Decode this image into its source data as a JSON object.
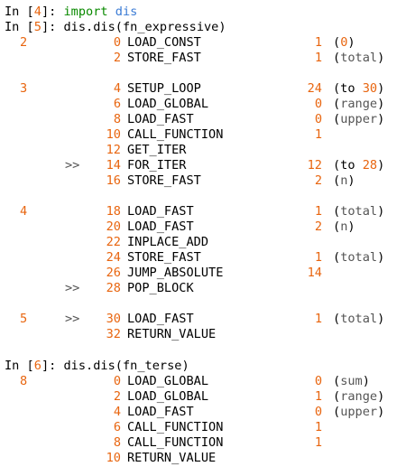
{
  "cells": [
    {
      "prompt_prefix": "In [",
      "prompt_num": "4",
      "prompt_suffix": "]: ",
      "kw": "import",
      "space": " ",
      "module": "dis"
    },
    {
      "prompt_prefix": "In [",
      "prompt_num": "5",
      "prompt_suffix": "]: ",
      "code": "dis.dis(fn_expressive)"
    },
    {
      "prompt_prefix": "In [",
      "prompt_num": "6",
      "prompt_suffix": "]: ",
      "code": "dis.dis(fn_terse)"
    }
  ],
  "disasm_expressive": [
    {
      "lineno": "2",
      "marker": "",
      "offset": "0",
      "opname": "LOAD_CONST",
      "arg": "1",
      "pre": "(",
      "num": "0",
      "str": "",
      "post": ")"
    },
    {
      "lineno": "",
      "marker": "",
      "offset": "2",
      "opname": "STORE_FAST",
      "arg": "1",
      "pre": "(",
      "num": "",
      "str": "total",
      "post": ")"
    },
    {
      "lineno": "3",
      "marker": "",
      "offset": "4",
      "opname": "SETUP_LOOP",
      "arg": "24",
      "pre": "(to ",
      "num": "30",
      "str": "",
      "post": ")"
    },
    {
      "lineno": "",
      "marker": "",
      "offset": "6",
      "opname": "LOAD_GLOBAL",
      "arg": "0",
      "pre": "(",
      "num": "",
      "str": "range",
      "post": ")"
    },
    {
      "lineno": "",
      "marker": "",
      "offset": "8",
      "opname": "LOAD_FAST",
      "arg": "0",
      "pre": "(",
      "num": "",
      "str": "upper",
      "post": ")"
    },
    {
      "lineno": "",
      "marker": "",
      "offset": "10",
      "opname": "CALL_FUNCTION",
      "arg": "1",
      "pre": "",
      "num": "",
      "str": "",
      "post": ""
    },
    {
      "lineno": "",
      "marker": "",
      "offset": "12",
      "opname": "GET_ITER",
      "arg": "",
      "pre": "",
      "num": "",
      "str": "",
      "post": ""
    },
    {
      "lineno": "",
      "marker": ">>",
      "offset": "14",
      "opname": "FOR_ITER",
      "arg": "12",
      "pre": "(to ",
      "num": "28",
      "str": "",
      "post": ")"
    },
    {
      "lineno": "",
      "marker": "",
      "offset": "16",
      "opname": "STORE_FAST",
      "arg": "2",
      "pre": "(",
      "num": "",
      "str": "n",
      "post": ")"
    },
    {
      "lineno": "4",
      "marker": "",
      "offset": "18",
      "opname": "LOAD_FAST",
      "arg": "1",
      "pre": "(",
      "num": "",
      "str": "total",
      "post": ")"
    },
    {
      "lineno": "",
      "marker": "",
      "offset": "20",
      "opname": "LOAD_FAST",
      "arg": "2",
      "pre": "(",
      "num": "",
      "str": "n",
      "post": ")"
    },
    {
      "lineno": "",
      "marker": "",
      "offset": "22",
      "opname": "INPLACE_ADD",
      "arg": "",
      "pre": "",
      "num": "",
      "str": "",
      "post": ""
    },
    {
      "lineno": "",
      "marker": "",
      "offset": "24",
      "opname": "STORE_FAST",
      "arg": "1",
      "pre": "(",
      "num": "",
      "str": "total",
      "post": ")"
    },
    {
      "lineno": "",
      "marker": "",
      "offset": "26",
      "opname": "JUMP_ABSOLUTE",
      "arg": "14",
      "pre": "",
      "num": "",
      "str": "",
      "post": ""
    },
    {
      "lineno": "",
      "marker": ">>",
      "offset": "28",
      "opname": "POP_BLOCK",
      "arg": "",
      "pre": "",
      "num": "",
      "str": "",
      "post": ""
    },
    {
      "lineno": "5",
      "marker": ">>",
      "offset": "30",
      "opname": "LOAD_FAST",
      "arg": "1",
      "pre": "(",
      "num": "",
      "str": "total",
      "post": ")"
    },
    {
      "lineno": "",
      "marker": "",
      "offset": "32",
      "opname": "RETURN_VALUE",
      "arg": "",
      "pre": "",
      "num": "",
      "str": "",
      "post": ""
    }
  ],
  "disasm_terse": [
    {
      "lineno": "8",
      "marker": "",
      "offset": "0",
      "opname": "LOAD_GLOBAL",
      "arg": "0",
      "pre": "(",
      "num": "",
      "str": "sum",
      "post": ")"
    },
    {
      "lineno": "",
      "marker": "",
      "offset": "2",
      "opname": "LOAD_GLOBAL",
      "arg": "1",
      "pre": "(",
      "num": "",
      "str": "range",
      "post": ")"
    },
    {
      "lineno": "",
      "marker": "",
      "offset": "4",
      "opname": "LOAD_FAST",
      "arg": "0",
      "pre": "(",
      "num": "",
      "str": "upper",
      "post": ")"
    },
    {
      "lineno": "",
      "marker": "",
      "offset": "6",
      "opname": "CALL_FUNCTION",
      "arg": "1",
      "pre": "",
      "num": "",
      "str": "",
      "post": ""
    },
    {
      "lineno": "",
      "marker": "",
      "offset": "8",
      "opname": "CALL_FUNCTION",
      "arg": "1",
      "pre": "",
      "num": "",
      "str": "",
      "post": ""
    },
    {
      "lineno": "",
      "marker": "",
      "offset": "10",
      "opname": "RETURN_VALUE",
      "arg": "",
      "pre": "",
      "num": "",
      "str": "",
      "post": ""
    }
  ]
}
